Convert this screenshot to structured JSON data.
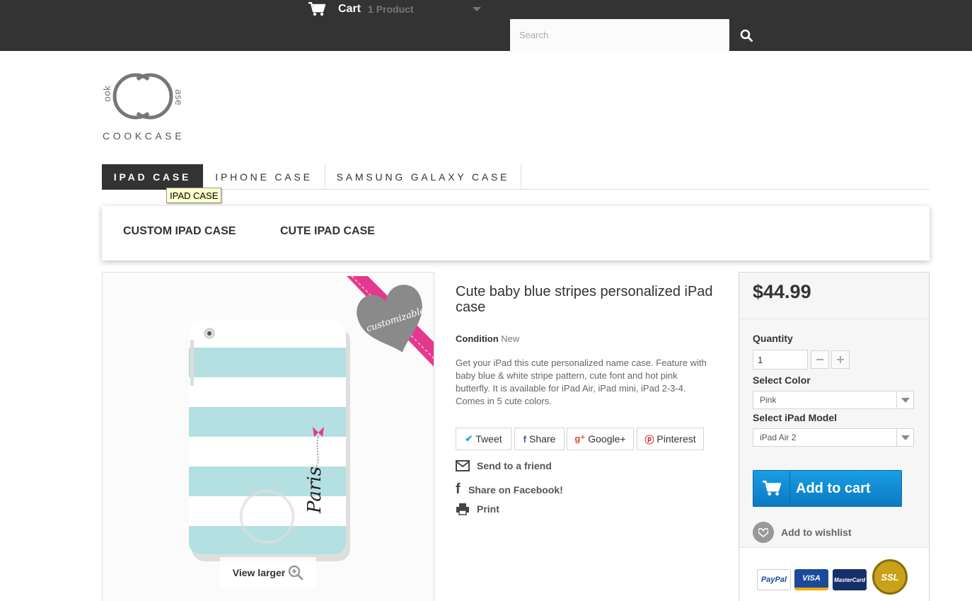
{
  "header": {
    "cart_label": "Cart",
    "cart_count": "1 Product",
    "search_placeholder": "Search"
  },
  "logo": {
    "brand": "COOKCASE"
  },
  "menu": {
    "items": [
      {
        "label": "IPAD CASE"
      },
      {
        "label": "IPHONE CASE"
      },
      {
        "label": "SAMSUNG GALAXY CASE"
      }
    ],
    "tooltip": "IPAD CASE"
  },
  "submenu": {
    "items": [
      {
        "label": "CUSTOM IPAD CASE"
      },
      {
        "label": "CUTE IPAD CASE"
      }
    ]
  },
  "product": {
    "title": "Cute baby blue stripes personalized iPad case",
    "condition_label": "Condition",
    "condition_value": "New",
    "description": "Get your iPad this cute personalized name case. Feature with baby blue & white stripe pattern, cute font and hot pink butterfly. It is available for iPad Air, iPad mini, iPad 2-3-4. Comes in 5 cute colors.",
    "image_text": {
      "badge": "customizable",
      "name": "Paris"
    },
    "view_larger": "View larger",
    "social": [
      {
        "label": "Tweet",
        "icon": "twitter-icon"
      },
      {
        "label": "Share",
        "icon": "facebook-icon"
      },
      {
        "label": "Google+",
        "icon": "google-plus-icon"
      },
      {
        "label": "Pinterest",
        "icon": "pinterest-icon"
      }
    ],
    "links": [
      {
        "label": "Send to a friend",
        "icon": "envelope-icon"
      },
      {
        "label": "Share on Facebook!",
        "icon": "facebook-icon"
      },
      {
        "label": "Print",
        "icon": "printer-icon"
      }
    ]
  },
  "buybox": {
    "price": "$44.99",
    "quantity_label": "Quantity",
    "quantity_value": "1",
    "color_label": "Select Color",
    "color_value": "Pink",
    "model_label": "Select iPad Model",
    "model_value": "iPad Air 2",
    "add_to_cart": "Add to cart",
    "wishlist": "Add to wishlist",
    "payments": [
      "PayPal",
      "VISA",
      "MasterCard",
      "SSL"
    ]
  },
  "colors": {
    "topbar": "#333333",
    "accent_blue": "#1a9ee3",
    "stripe_blue": "#b5e0e2",
    "ribbon_pink": "#e5398e"
  }
}
